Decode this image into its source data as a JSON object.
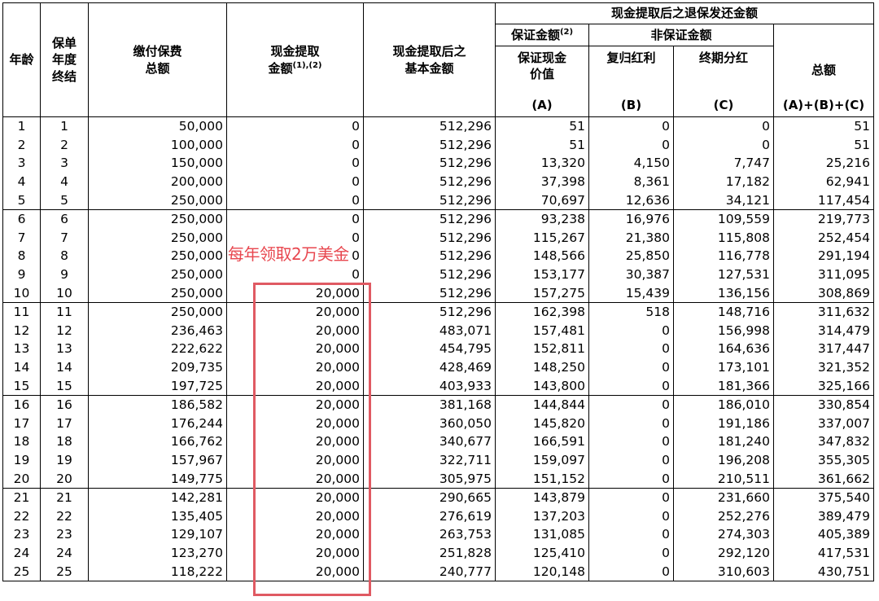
{
  "header": {
    "age": "年龄",
    "policy_year_end": [
      "保单",
      "年度",
      "终结"
    ],
    "premium_paid": [
      "缴付保费",
      "总额"
    ],
    "withdrawal_amount": [
      "现金提取",
      "金额"
    ],
    "withdrawal_amount_sup": "(1),(2)",
    "basic_amount_after": [
      "现金提取后之",
      "基本金额"
    ],
    "surrender_group": "现金提取后之退保发还金额",
    "guaranteed_amount": "保证金额",
    "guaranteed_amount_sup": "(2)",
    "non_guaranteed_amount": "非保证金额",
    "guaranteed_cash_value": [
      "保证现金",
      "价值"
    ],
    "reversionary_bonus": "复归红利",
    "terminal_dividend": "终期分红",
    "total": "总额",
    "letter_a": "(A)",
    "letter_b": "(B)",
    "letter_c": "(C)",
    "letter_total": "(A)+(B)+(C)"
  },
  "rows": [
    {
      "age": "1",
      "year": "1",
      "premium": "50,000",
      "withdrawal": "0",
      "basic": "512,296",
      "gcv": "51",
      "rev": "0",
      "term": "0",
      "total": "51"
    },
    {
      "age": "2",
      "year": "2",
      "premium": "100,000",
      "withdrawal": "0",
      "basic": "512,296",
      "gcv": "51",
      "rev": "0",
      "term": "0",
      "total": "51"
    },
    {
      "age": "3",
      "year": "3",
      "premium": "150,000",
      "withdrawal": "0",
      "basic": "512,296",
      "gcv": "13,320",
      "rev": "4,150",
      "term": "7,747",
      "total": "25,216"
    },
    {
      "age": "4",
      "year": "4",
      "premium": "200,000",
      "withdrawal": "0",
      "basic": "512,296",
      "gcv": "37,398",
      "rev": "8,361",
      "term": "17,182",
      "total": "62,941"
    },
    {
      "age": "5",
      "year": "5",
      "premium": "250,000",
      "withdrawal": "0",
      "basic": "512,296",
      "gcv": "70,697",
      "rev": "12,636",
      "term": "34,121",
      "total": "117,454"
    },
    {
      "age": "6",
      "year": "6",
      "premium": "250,000",
      "withdrawal": "0",
      "basic": "512,296",
      "gcv": "93,238",
      "rev": "16,976",
      "term": "109,559",
      "total": "219,773"
    },
    {
      "age": "7",
      "year": "7",
      "premium": "250,000",
      "withdrawal": "0",
      "basic": "512,296",
      "gcv": "115,267",
      "rev": "21,380",
      "term": "115,808",
      "total": "252,454"
    },
    {
      "age": "8",
      "year": "8",
      "premium": "250,000",
      "withdrawal": "0",
      "basic": "512,296",
      "gcv": "148,566",
      "rev": "25,850",
      "term": "116,778",
      "total": "291,194"
    },
    {
      "age": "9",
      "year": "9",
      "premium": "250,000",
      "withdrawal": "0",
      "basic": "512,296",
      "gcv": "153,177",
      "rev": "30,387",
      "term": "127,531",
      "total": "311,095"
    },
    {
      "age": "10",
      "year": "10",
      "premium": "250,000",
      "withdrawal": "20,000",
      "basic": "512,296",
      "gcv": "157,275",
      "rev": "15,439",
      "term": "136,156",
      "total": "308,869"
    },
    {
      "age": "11",
      "year": "11",
      "premium": "250,000",
      "withdrawal": "20,000",
      "basic": "512,296",
      "gcv": "162,398",
      "rev": "518",
      "term": "148,716",
      "total": "311,632"
    },
    {
      "age": "12",
      "year": "12",
      "premium": "236,463",
      "withdrawal": "20,000",
      "basic": "483,071",
      "gcv": "157,481",
      "rev": "0",
      "term": "156,998",
      "total": "314,479"
    },
    {
      "age": "13",
      "year": "13",
      "premium": "222,622",
      "withdrawal": "20,000",
      "basic": "454,795",
      "gcv": "152,811",
      "rev": "0",
      "term": "164,636",
      "total": "317,447"
    },
    {
      "age": "14",
      "year": "14",
      "premium": "209,735",
      "withdrawal": "20,000",
      "basic": "428,469",
      "gcv": "148,250",
      "rev": "0",
      "term": "173,101",
      "total": "321,352"
    },
    {
      "age": "15",
      "year": "15",
      "premium": "197,725",
      "withdrawal": "20,000",
      "basic": "403,933",
      "gcv": "143,800",
      "rev": "0",
      "term": "181,366",
      "total": "325,166"
    },
    {
      "age": "16",
      "year": "16",
      "premium": "186,582",
      "withdrawal": "20,000",
      "basic": "381,168",
      "gcv": "144,844",
      "rev": "0",
      "term": "186,010",
      "total": "330,854"
    },
    {
      "age": "17",
      "year": "17",
      "premium": "176,244",
      "withdrawal": "20,000",
      "basic": "360,050",
      "gcv": "145,820",
      "rev": "0",
      "term": "191,186",
      "total": "337,007"
    },
    {
      "age": "18",
      "year": "18",
      "premium": "166,762",
      "withdrawal": "20,000",
      "basic": "340,677",
      "gcv": "166,591",
      "rev": "0",
      "term": "181,240",
      "total": "347,832"
    },
    {
      "age": "19",
      "year": "19",
      "premium": "157,967",
      "withdrawal": "20,000",
      "basic": "322,711",
      "gcv": "159,097",
      "rev": "0",
      "term": "196,208",
      "total": "355,305"
    },
    {
      "age": "20",
      "year": "20",
      "premium": "149,775",
      "withdrawal": "20,000",
      "basic": "305,975",
      "gcv": "151,152",
      "rev": "0",
      "term": "210,511",
      "total": "361,662"
    },
    {
      "age": "21",
      "year": "21",
      "premium": "142,281",
      "withdrawal": "20,000",
      "basic": "290,665",
      "gcv": "143,879",
      "rev": "0",
      "term": "231,660",
      "total": "375,540"
    },
    {
      "age": "22",
      "year": "22",
      "premium": "135,405",
      "withdrawal": "20,000",
      "basic": "276,619",
      "gcv": "137,203",
      "rev": "0",
      "term": "252,276",
      "total": "389,479"
    },
    {
      "age": "23",
      "year": "23",
      "premium": "129,107",
      "withdrawal": "20,000",
      "basic": "263,753",
      "gcv": "131,085",
      "rev": "0",
      "term": "274,303",
      "total": "405,389"
    },
    {
      "age": "24",
      "year": "24",
      "premium": "123,270",
      "withdrawal": "20,000",
      "basic": "251,828",
      "gcv": "125,410",
      "rev": "0",
      "term": "292,120",
      "total": "417,531"
    },
    {
      "age": "25",
      "year": "25",
      "premium": "118,222",
      "withdrawal": "20,000",
      "basic": "240,777",
      "gcv": "120,148",
      "rev": "0",
      "term": "310,603",
      "total": "430,751"
    }
  ],
  "annotation": {
    "text": "每年领取2万美金",
    "color": "#e8474f",
    "box_color": "#e05a63"
  }
}
